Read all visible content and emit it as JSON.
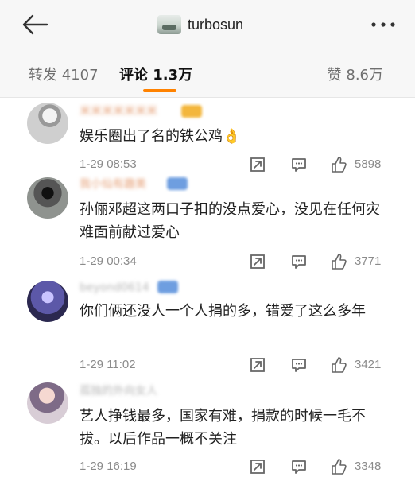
{
  "header": {
    "account_name": "turbosun",
    "icons": {
      "back": "back-arrow-icon",
      "more": "more-dots-icon"
    }
  },
  "tabs": {
    "repost": "转发 4107",
    "comments": "评论 1.3万",
    "likes": "赞 8.6万"
  },
  "colors": {
    "accent": "#ff8200",
    "name_blur": "#e6a27a",
    "badge_gold": "#f3b63c",
    "badge_blue": "#6e9ee0",
    "timestamp": "#8b8b8b"
  },
  "comments": [
    {
      "name": "米米米米米米米",
      "text": "娱乐圈出了名的铁公鸡👌",
      "time": "1-29 08:53",
      "likes": "5898"
    },
    {
      "name": "我小仙有趣美",
      "text": "孙俪邓超这两口子扣的没点爱心，没见在任何灾难面前献过爱心",
      "time": "1-29 00:34",
      "likes": "3771"
    },
    {
      "name": "beyond0614",
      "text": "你们俩还没人一个人捐的多，错爱了这么多年",
      "time": "1-29 11:02",
      "likes": "3421"
    },
    {
      "name": "孤独的外向女人",
      "text": "艺人挣钱最多，国家有难，捐款的时候一毛不拔。以后作品一概不关注",
      "time": "1-29 16:19",
      "likes": "3348"
    }
  ]
}
